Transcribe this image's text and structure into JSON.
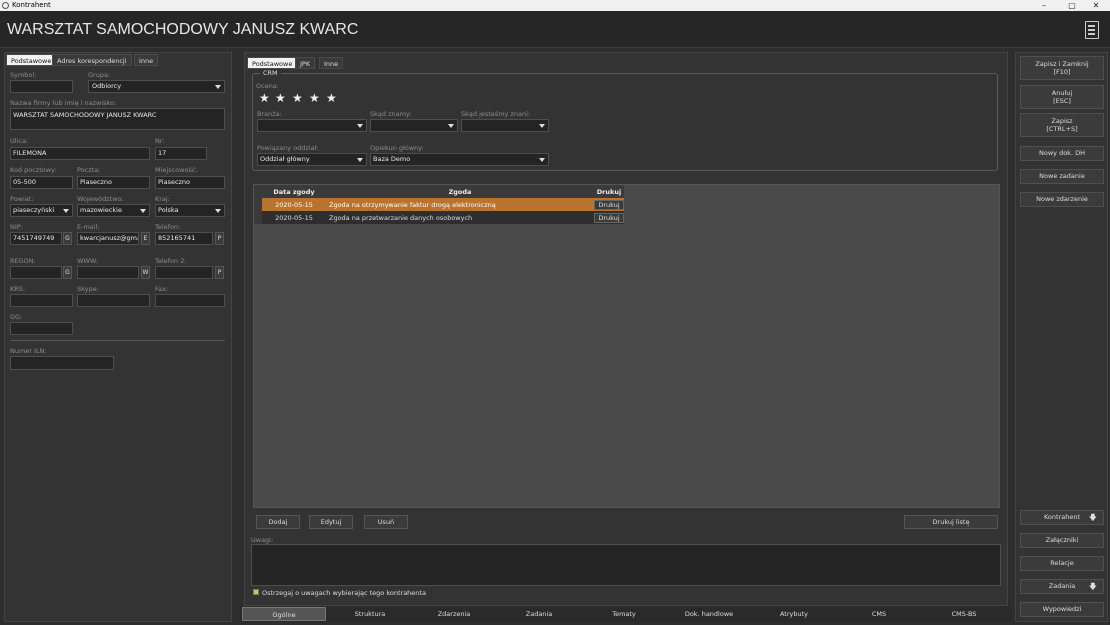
{
  "window": {
    "title": "Kontrahent",
    "controls": [
      "–",
      "▢",
      "✕"
    ]
  },
  "header": {
    "title": "WARSZTAT SAMOCHODOWY JANUSZ KWARC",
    "icon": "document-list-icon"
  },
  "left_tabs": [
    "Podstawowe",
    "Adres korespondencji",
    "Inne"
  ],
  "form": {
    "symbol_label": "Symbol:",
    "symbol": "",
    "grupa_label": "Grupa:",
    "grupa": "Odbiorcy",
    "nazwa_label": "Nazwa firmy lub imię i nazwisko:",
    "nazwa": "WARSZTAT SAMOCHODOWY JANUSZ KWARC",
    "ulica_label": "Ulica:",
    "ulica": "FILEMONA",
    "nr_label": "Nr:",
    "nr": "17",
    "kod_label": "Kod pocztowy:",
    "kod": "05-500",
    "poczta_label": "Poczta:",
    "poczta": "Piaseczno",
    "miejscowosc_label": "Miejscowość:",
    "miejscowosc": "Piaseczno",
    "powiat_label": "Powiat:",
    "powiat": "piaseczyński",
    "woj_label": "Województwo:",
    "woj": "mazowieckie",
    "kraj_label": "Kraj:",
    "kraj": "Polska",
    "nip_label": "NIP:",
    "nip": "7451749749",
    "nip_btn": "G",
    "email_label": "E-mail:",
    "email": "kwarcjanusz@gma",
    "email_btn": "E",
    "tel_label": "Telefon:",
    "tel": "852165741",
    "tel_btn": "P",
    "regon_label": "REGON:",
    "regon": "",
    "regon_btn": "G",
    "www_label": "WWW:",
    "www": "",
    "www_btn": "W",
    "tel2_label": "Telefon 2:",
    "tel2": "",
    "tel2_btn": "P",
    "krs_label": "KRS:",
    "krs": "",
    "skype_label": "Skype:",
    "skype": "",
    "fax_label": "Fax:",
    "fax": "",
    "gg_label": "GG:",
    "gg": "",
    "iln_label": "Numer ILN:",
    "iln": ""
  },
  "center_tabs": [
    "Podstawowe",
    "JPK",
    "Inne"
  ],
  "crm": {
    "legend": "CRM",
    "ocena_label": "Ocena:",
    "rating": 5,
    "branza_label": "Branża:",
    "branza": "",
    "skad_label": "Skąd znamy:",
    "skad": "",
    "skadj_label": "Skąd jesteśmy znani:",
    "skadj": "",
    "oddzial_label": "Powiązany oddział:",
    "oddzial": "Oddział główny",
    "opiekun_label": "Opiekun główny:",
    "opiekun": "Baza Demo"
  },
  "consents": {
    "headers": [
      "Data zgody",
      "Zgoda",
      "Drukuj"
    ],
    "rows": [
      {
        "date": "2020-05-15",
        "text": "Zgoda na otrzymywanie faktur drogą elektroniczną",
        "btn": "Drukuj"
      },
      {
        "date": "2020-05-15",
        "text": "Zgoda na przetwarzanie danych osobowych",
        "btn": "Drukuj"
      }
    ]
  },
  "buttons": {
    "dodaj": "Dodaj",
    "edytuj": "Edytuj",
    "usun": "Usuń",
    "drukuj_liste": "Drukuj listę"
  },
  "uwagi_label": "Uwagi:",
  "warn_label": "Ostrzegaj o uwagach wybierając tego kontrahenta",
  "bottom_tabs": [
    "Ogólne",
    "Struktura",
    "Zdarzenia",
    "Zadania",
    "Tematy",
    "Dok. handlowe",
    "Atrybuty",
    "CMS",
    "CMS-BS"
  ],
  "right_buttons": {
    "save_close": "Zapisz i Zamknij",
    "save_close_key": "[F10]",
    "cancel": "Anuluj",
    "cancel_key": "[ESC]",
    "save": "Zapisz",
    "save_key": "[CTRL+S]",
    "nowy_dok": "Nowy dok. DH",
    "nowe_zadanie": "Nowe zadanie",
    "nowe_zdarzenie": "Nowe zdarzenie",
    "kontrahent": "Kontrahent",
    "zalaczniki": "Załączniki",
    "relacje": "Relacje",
    "zadania": "Zadania",
    "wypowiedzi": "Wypowiedzi"
  },
  "colors": {
    "accent": "#b8742e",
    "bg": "#2e2e2e"
  }
}
